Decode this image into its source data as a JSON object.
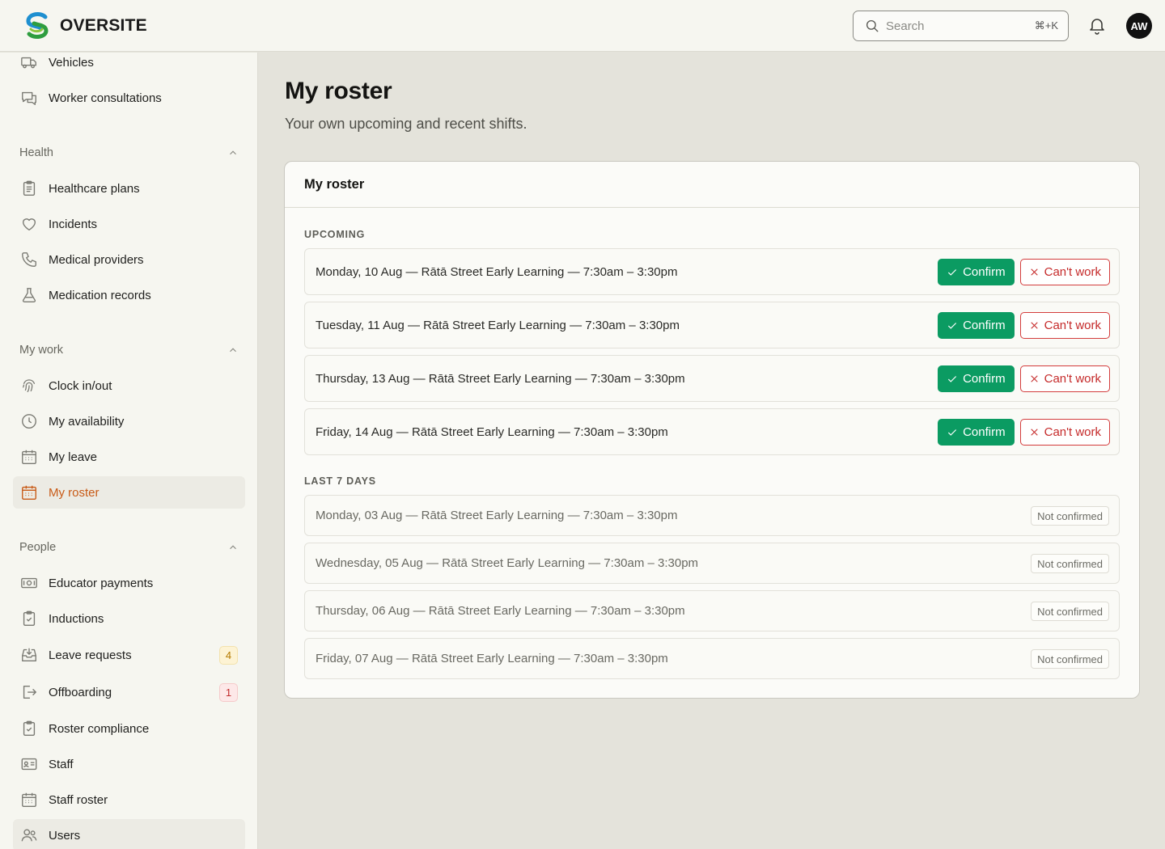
{
  "brand": {
    "name": "OVERSITE"
  },
  "header": {
    "search_placeholder": "Search",
    "search_shortcut": "⌘+K",
    "avatar_initials": "AW"
  },
  "sidebar": {
    "items_top": [
      {
        "label": "Vehicles",
        "icon": "truck-icon"
      },
      {
        "label": "Worker consultations",
        "icon": "chat-bubbles-icon"
      }
    ],
    "sections": [
      {
        "title": "Health",
        "items": [
          {
            "label": "Healthcare plans",
            "icon": "clipboard-list-icon"
          },
          {
            "label": "Incidents",
            "icon": "heart-icon"
          },
          {
            "label": "Medical providers",
            "icon": "phone-icon"
          },
          {
            "label": "Medication records",
            "icon": "flask-icon"
          }
        ]
      },
      {
        "title": "My work",
        "items": [
          {
            "label": "Clock in/out",
            "icon": "fingerprint-icon"
          },
          {
            "label": "My availability",
            "icon": "clock-icon"
          },
          {
            "label": "My leave",
            "icon": "calendar-icon"
          },
          {
            "label": "My roster",
            "icon": "calendar-icon",
            "active": true
          }
        ]
      },
      {
        "title": "People",
        "items": [
          {
            "label": "Educator payments",
            "icon": "cash-icon"
          },
          {
            "label": "Inductions",
            "icon": "clipboard-check-icon"
          },
          {
            "label": "Leave requests",
            "icon": "inbox-download-icon",
            "badge": "4"
          },
          {
            "label": "Offboarding",
            "icon": "logout-icon",
            "badge": "1"
          },
          {
            "label": "Roster compliance",
            "icon": "clipboard-check-icon"
          },
          {
            "label": "Staff",
            "icon": "id-card-icon"
          },
          {
            "label": "Staff roster",
            "icon": "calendar-icon"
          },
          {
            "label": "Users",
            "icon": "users-icon"
          }
        ]
      }
    ]
  },
  "main": {
    "title": "My roster",
    "subtitle": "Your own upcoming and recent shifts.",
    "card_title": "My roster",
    "upcoming_label": "UPCOMING",
    "past_label": "LAST 7 DAYS",
    "confirm_label": "Confirm",
    "cant_work_label": "Can't work",
    "upcoming": [
      "Monday, 10 Aug — Rātā Street Early Learning — 7:30am – 3:30pm",
      "Tuesday, 11 Aug — Rātā Street Early Learning — 7:30am – 3:30pm",
      "Thursday, 13 Aug — Rātā Street Early Learning — 7:30am – 3:30pm",
      "Friday, 14 Aug — Rātā Street Early Learning — 7:30am – 3:30pm"
    ],
    "past": [
      {
        "text": "Monday, 03 Aug — Rātā Street Early Learning — 7:30am – 3:30pm",
        "status": "Not confirmed"
      },
      {
        "text": "Wednesday, 05 Aug — Rātā Street Early Learning — 7:30am – 3:30pm",
        "status": "Not confirmed"
      },
      {
        "text": "Thursday, 06 Aug — Rātā Street Early Learning — 7:30am – 3:30pm",
        "status": "Not confirmed"
      },
      {
        "text": "Friday, 07 Aug — Rātā Street Early Learning — 7:30am – 3:30pm",
        "status": "Not confirmed"
      }
    ]
  },
  "colors": {
    "accent": "#c85a16",
    "confirm": "#0b9b62",
    "danger": "#c52a2a"
  }
}
